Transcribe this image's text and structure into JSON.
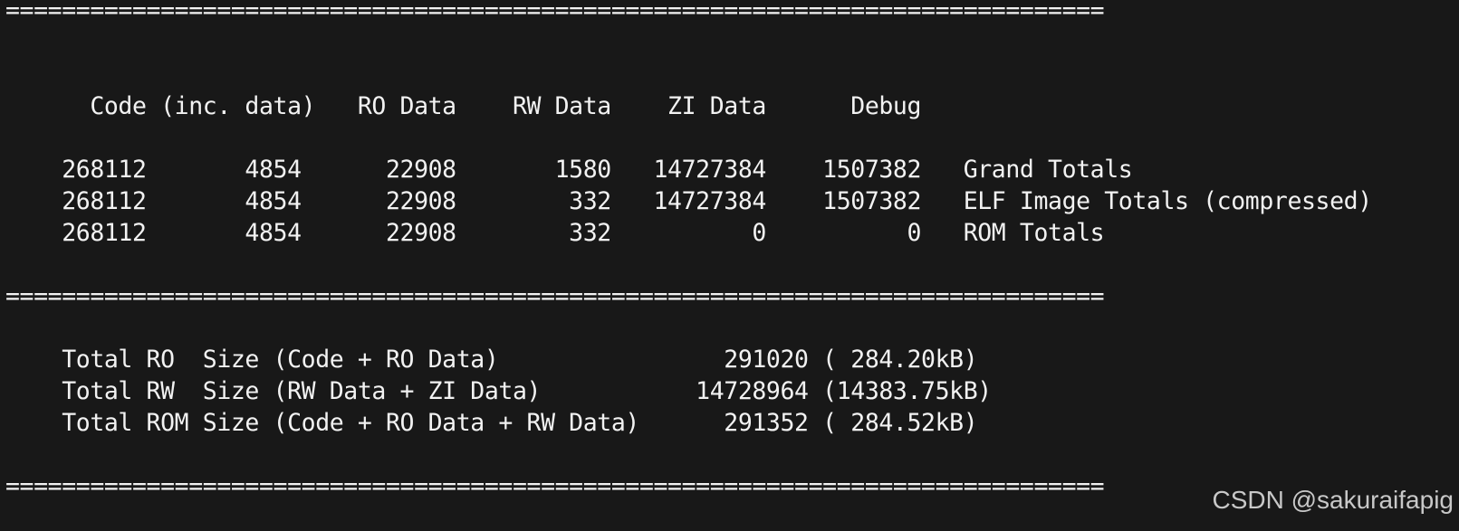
{
  "terminal": {
    "separator_top": "==============================================================================",
    "header_line": "      Code (inc. data)   RO Data    RW Data    ZI Data      Debug",
    "rows": [
      "    268112       4854      22908       1580   14727384    1507382   Grand Totals",
      "    268112       4854      22908        332   14727384    1507382   ELF Image Totals (compressed)",
      "    268112       4854      22908        332          0          0   ROM Totals"
    ],
    "separator_mid": "==============================================================================",
    "summary": [
      "    Total RO  Size (Code + RO Data)                291020 ( 284.20kB)",
      "    Total RW  Size (RW Data + ZI Data)           14728964 (14383.75kB)",
      "    Total ROM Size (Code + RO Data + RW Data)      291352 ( 284.52kB)"
    ],
    "separator_bottom": "=============================================================================="
  },
  "watermark": "CSDN @sakuraifapig"
}
